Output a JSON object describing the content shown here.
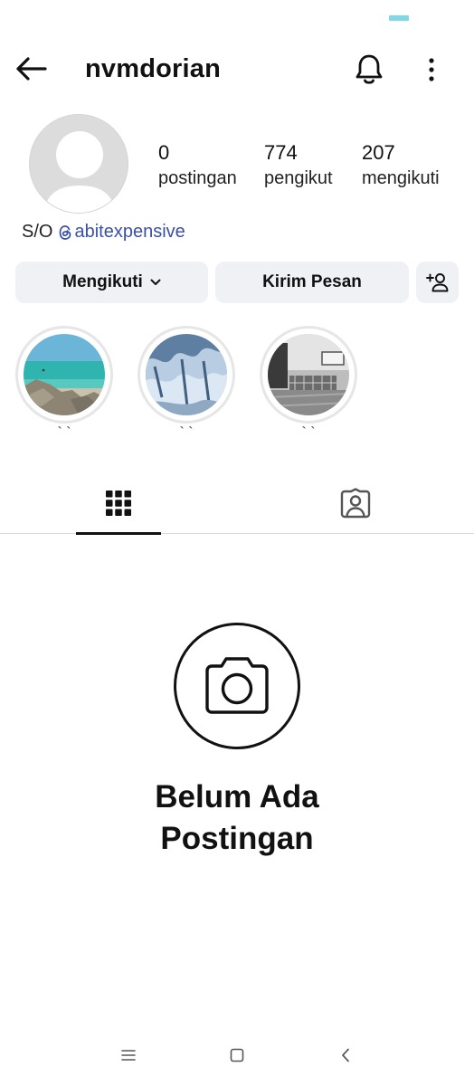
{
  "header": {
    "username": "nvmdorian"
  },
  "stats": [
    {
      "value": "0",
      "label": "postingan"
    },
    {
      "value": "774",
      "label": "pengikut"
    },
    {
      "value": "207",
      "label": "mengikuti"
    }
  ],
  "bio": {
    "text": "S/O",
    "mention": "abitexpensive"
  },
  "actions": {
    "follow_label": "Mengikuti",
    "message_label": "Kirim Pesan"
  },
  "highlights": [
    {
      "caption": "` `"
    },
    {
      "caption": "` `"
    },
    {
      "caption": "` `"
    }
  ],
  "empty_state": {
    "title": "Belum Ada Postingan"
  },
  "colors": {
    "accent_link": "#3950a8",
    "button_bg": "#eff1f4",
    "status_indicator": "#7fd8e6"
  },
  "icons": [
    "back-arrow-icon",
    "bell-icon",
    "more-vertical-icon",
    "chevron-down-icon",
    "add-person-icon",
    "grid-icon",
    "tagged-person-icon",
    "camera-icon",
    "threads-icon",
    "menu-icon",
    "home-square-icon",
    "back-chevron-icon"
  ]
}
